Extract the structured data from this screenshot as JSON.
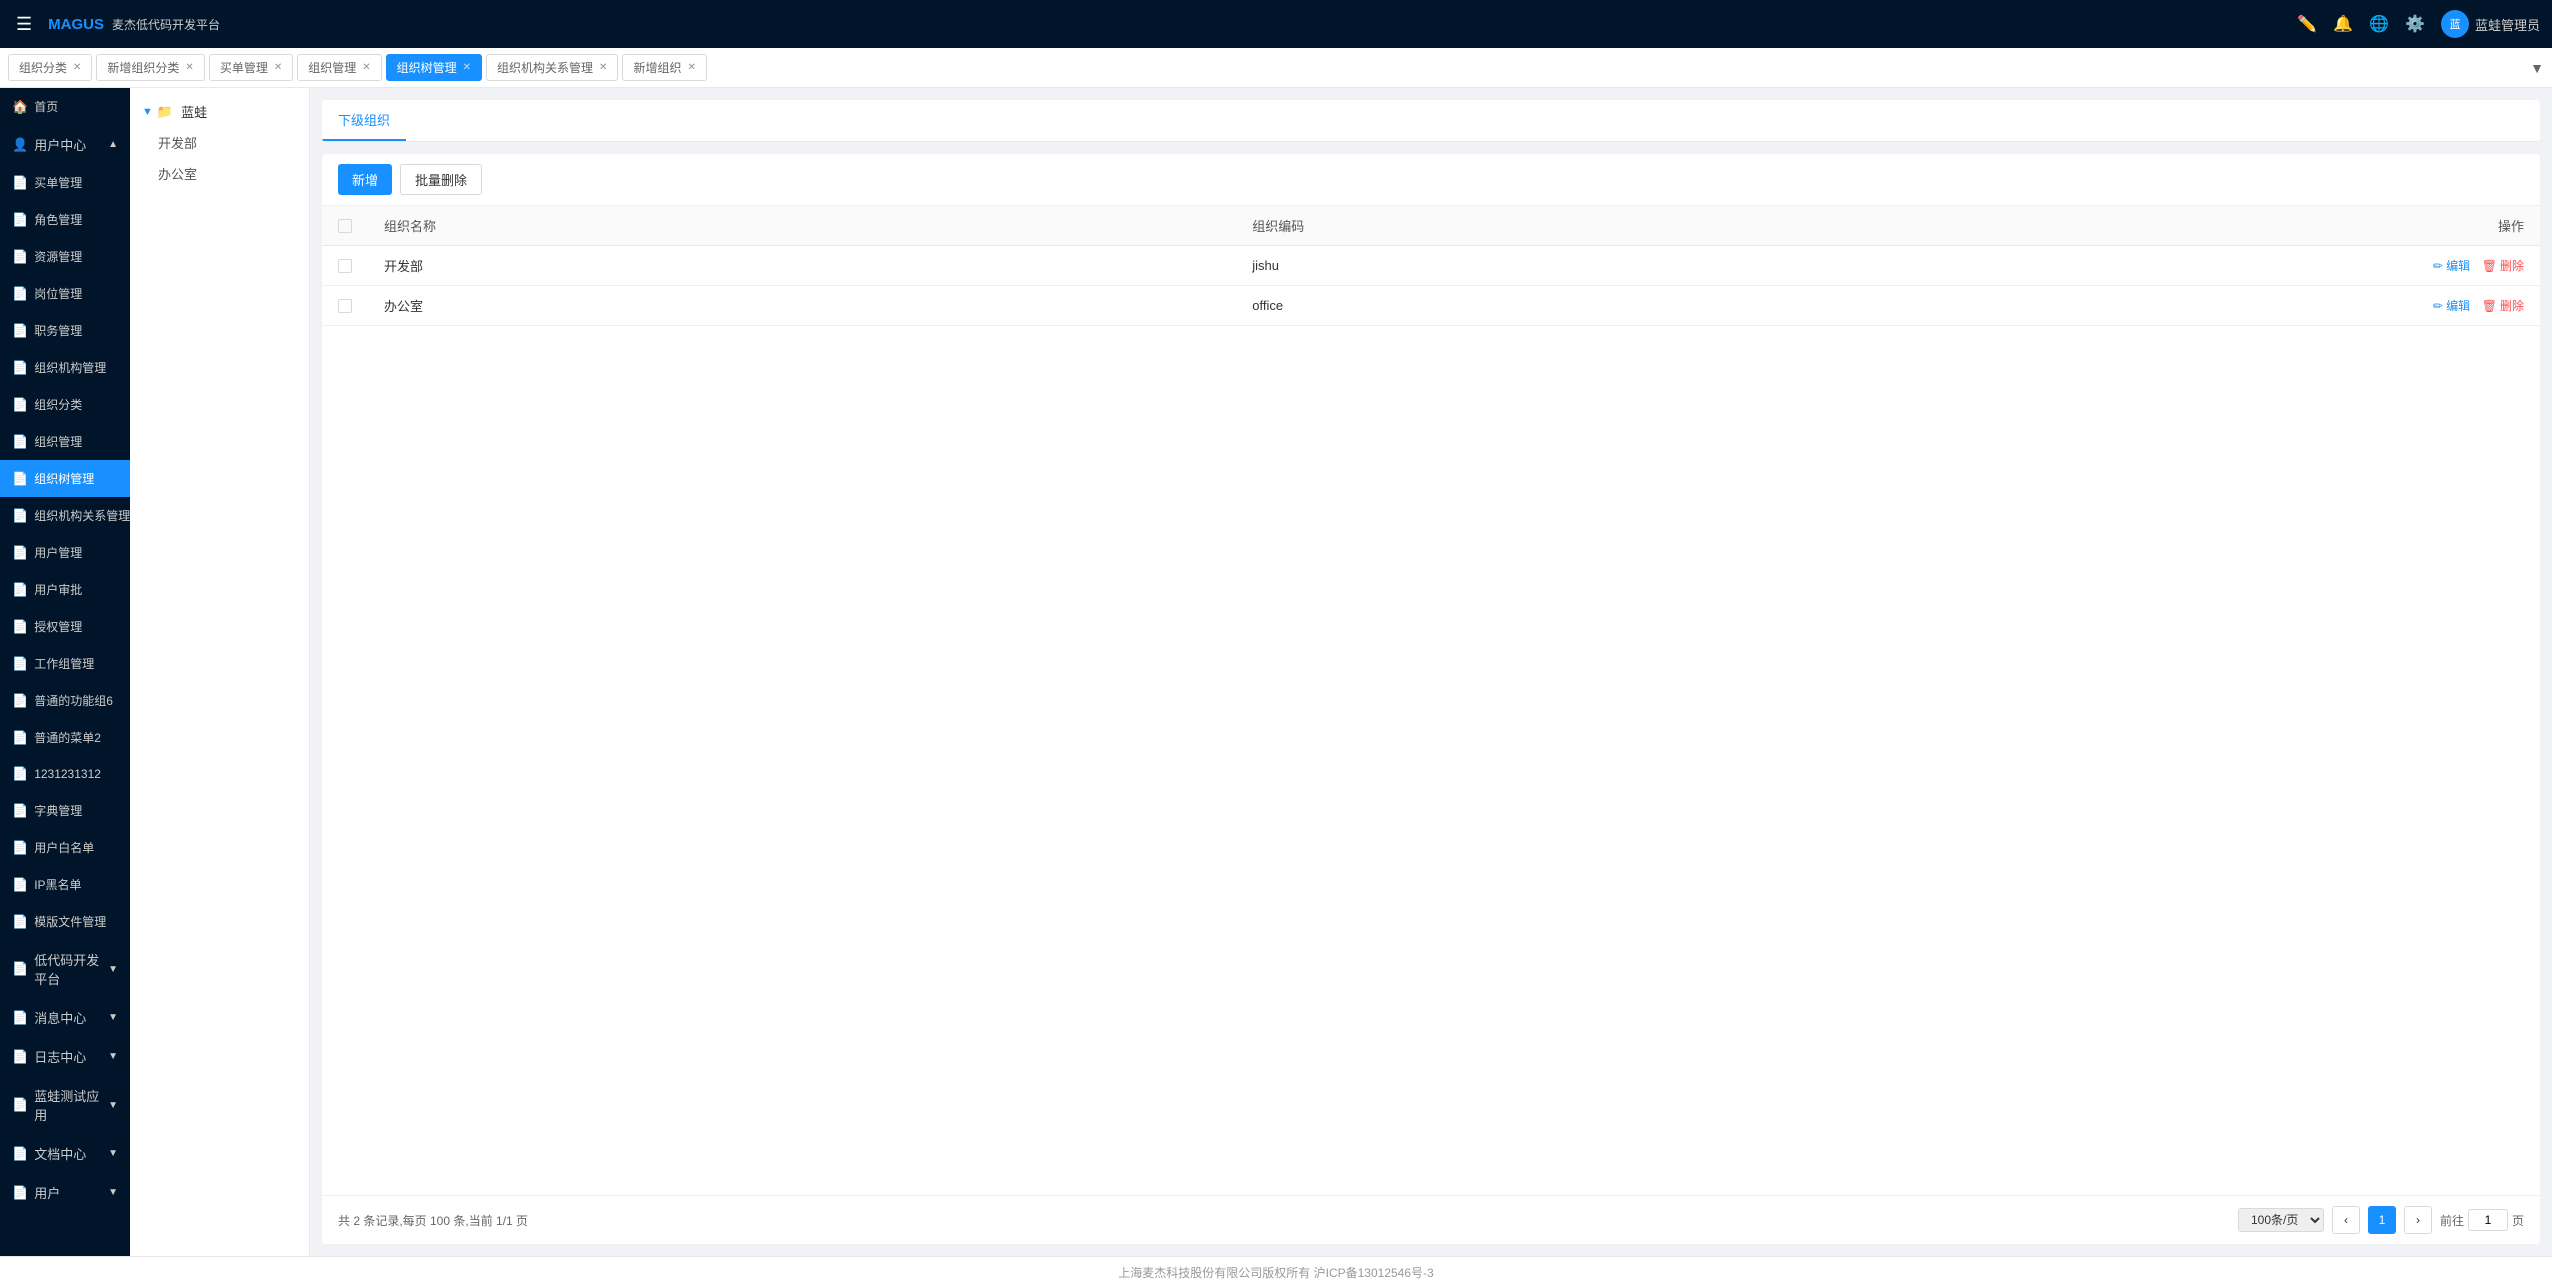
{
  "header": {
    "logo": "MAGUS",
    "subtitle": "麦杰低代码开发平台",
    "menu_icon": "☰",
    "icons": [
      "edit-icon",
      "bell-icon",
      "translate-icon",
      "settings-icon"
    ],
    "user": "蓝蛙管理员"
  },
  "tabs": [
    {
      "id": "tab-org-category",
      "label": "组织分类",
      "closable": true,
      "active": false
    },
    {
      "id": "tab-add-org-category",
      "label": "新增组织分类",
      "closable": true,
      "active": false
    },
    {
      "id": "tab-purchase",
      "label": "买单管理",
      "closable": true,
      "active": false
    },
    {
      "id": "tab-org-mgmt",
      "label": "组织管理",
      "closable": true,
      "active": false
    },
    {
      "id": "tab-org-tree",
      "label": "组织树管理",
      "closable": true,
      "active": true
    },
    {
      "id": "tab-org-relation",
      "label": "组织机构关系管理",
      "closable": true,
      "active": false
    },
    {
      "id": "tab-add-org",
      "label": "新增组织",
      "closable": true,
      "active": false
    }
  ],
  "sidebar": {
    "items": [
      {
        "id": "home",
        "label": "首页",
        "icon": "🏠"
      },
      {
        "id": "user-center",
        "label": "用户中心",
        "icon": "👤",
        "hasArrow": true
      },
      {
        "id": "purchase-mgmt",
        "label": "买单管理",
        "icon": "📄"
      },
      {
        "id": "role-mgmt",
        "label": "角色管理",
        "icon": "📄"
      },
      {
        "id": "resource-mgmt",
        "label": "资源管理",
        "icon": "📄"
      },
      {
        "id": "position-mgmt",
        "label": "岗位管理",
        "icon": "📄"
      },
      {
        "id": "job-mgmt",
        "label": "职务管理",
        "icon": "📄"
      },
      {
        "id": "org-structure-mgmt",
        "label": "组织机构管理",
        "icon": "📄"
      },
      {
        "id": "org-category",
        "label": "组织分类",
        "icon": "📄"
      },
      {
        "id": "org-management",
        "label": "组织管理",
        "icon": "📄"
      },
      {
        "id": "org-tree-mgmt",
        "label": "组织树管理",
        "icon": "📄",
        "active": true
      },
      {
        "id": "org-relation-mgmt",
        "label": "组织机构关系管理",
        "icon": "📄"
      },
      {
        "id": "user-mgmt",
        "label": "用户管理",
        "icon": "📄"
      },
      {
        "id": "user-audit",
        "label": "用户审批",
        "icon": "📄"
      },
      {
        "id": "auth-mgmt",
        "label": "授权管理",
        "icon": "📄"
      },
      {
        "id": "workgroup-mgmt",
        "label": "工作组管理",
        "icon": "📄"
      },
      {
        "id": "common-group6",
        "label": "普通的功能组6",
        "icon": "📄"
      },
      {
        "id": "common-menu2",
        "label": "普通的菜单2",
        "icon": "📄"
      },
      {
        "id": "menu-1231231312",
        "label": "1231231312",
        "icon": "📄"
      },
      {
        "id": "dict-mgmt",
        "label": "字典管理",
        "icon": "📄"
      },
      {
        "id": "user-whitelist",
        "label": "用户白名单",
        "icon": "📄"
      },
      {
        "id": "ip-blacklist",
        "label": "IP黑名单",
        "icon": "📄"
      },
      {
        "id": "template-file-mgmt",
        "label": "模版文件管理",
        "icon": "📄"
      },
      {
        "id": "low-code-dev",
        "label": "低代码开发平台",
        "icon": "📄",
        "hasArrow": true
      },
      {
        "id": "message-center",
        "label": "消息中心",
        "icon": "📄",
        "hasArrow": true
      },
      {
        "id": "log-center",
        "label": "日志中心",
        "icon": "📄",
        "hasArrow": true
      },
      {
        "id": "bluefrog-test",
        "label": "蓝蛙测试应用",
        "icon": "📄",
        "hasArrow": true
      },
      {
        "id": "doc-center",
        "label": "文档中心",
        "icon": "📄",
        "hasArrow": true
      },
      {
        "id": "user-bottom",
        "label": "用户",
        "icon": "📄",
        "hasArrow": true
      }
    ]
  },
  "tree": {
    "root": {
      "label": "蓝蛙",
      "expanded": true
    },
    "children": [
      {
        "label": "开发部"
      },
      {
        "label": "办公室"
      }
    ]
  },
  "section_tabs": [
    {
      "id": "sub-org",
      "label": "下级组织",
      "active": true
    }
  ],
  "toolbar": {
    "add_label": "新增",
    "batch_delete_label": "批量删除"
  },
  "table": {
    "columns": [
      {
        "id": "check",
        "label": ""
      },
      {
        "id": "name",
        "label": "组织名称"
      },
      {
        "id": "code",
        "label": "组织编码"
      },
      {
        "id": "action",
        "label": "操作"
      }
    ],
    "rows": [
      {
        "id": "row-1",
        "name": "开发部",
        "code": "jishu"
      },
      {
        "id": "row-2",
        "name": "办公室",
        "code": "office"
      }
    ],
    "action_edit": "编辑",
    "action_delete": "删除"
  },
  "pagination": {
    "total_text": "共 2 条记录,每页 100 条,当前 1/1 页",
    "page_size": "100条/页",
    "current_page": "1",
    "jump_label": "前往",
    "page_unit": "页"
  },
  "footer": {
    "text": "上海麦杰科技股份有限公司版权所有   沪ICP备13012546号-3"
  }
}
